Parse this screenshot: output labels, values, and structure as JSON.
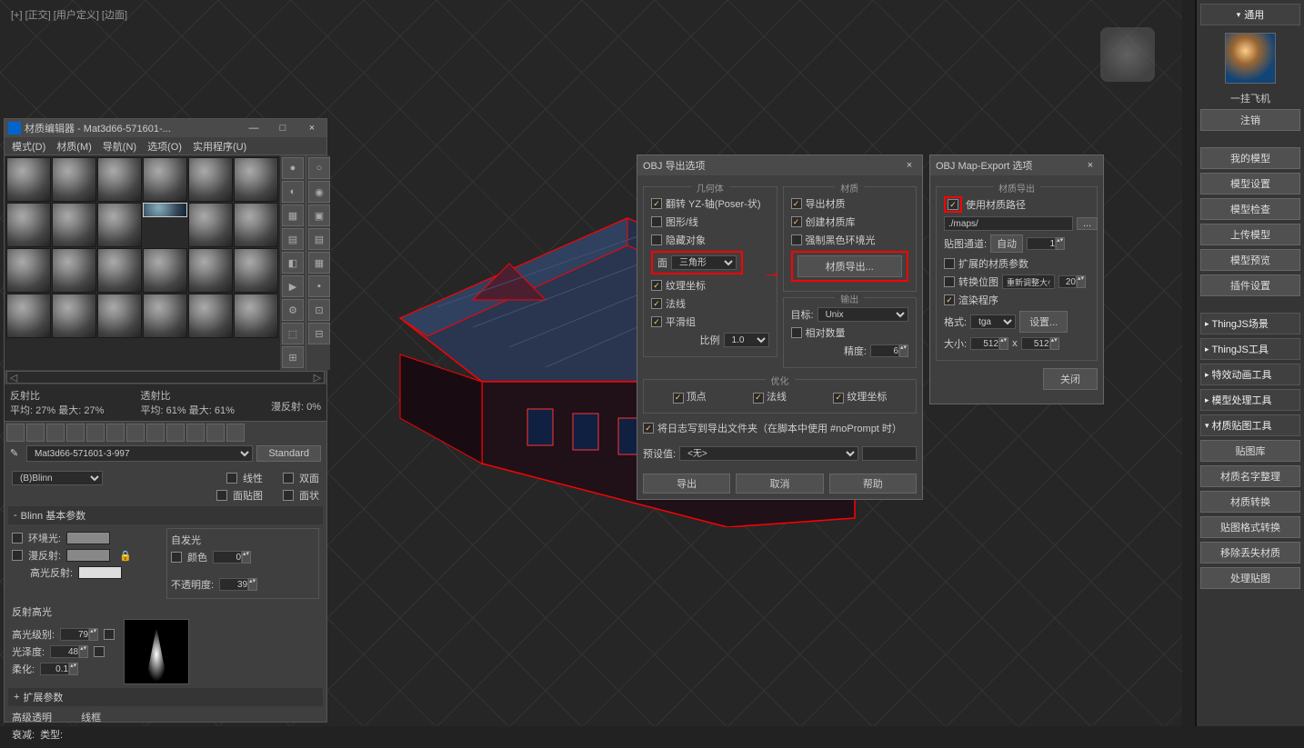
{
  "viewport_label": "[+] [正交] [用户定义] [边面]",
  "mateditor": {
    "title": "材质编辑器 - Mat3d66-571601-...",
    "menus": [
      "模式(D)",
      "材质(M)",
      "导航(N)",
      "选项(O)",
      "实用程序(U)"
    ],
    "stats": {
      "refl_label": "反射比",
      "refl_avg_label": "平均:",
      "refl_avg": "27%",
      "refl_max_label": "最大:",
      "refl_max": "27%",
      "trans_label": "透射比",
      "trans_avg": "61%",
      "trans_max": "61%",
      "diff_label": "漫反射:",
      "diff_val": "0%"
    },
    "mat_name": "Mat3d66-571601-3-997",
    "mat_type": "Standard",
    "shader": "(B)Blinn",
    "shader_opts": {
      "xianxing": "线性",
      "shuangmian": "双面",
      "mian_tie": "面贴图",
      "mian_zhuang": "面状"
    },
    "rollout_blinn": "Blinn 基本参数",
    "self_illum": "自发光",
    "color_label": "颜色",
    "color_val": "0",
    "ambient_label": "环境光:",
    "diffuse_label": "漫反射:",
    "specular_label": "高光反射:",
    "opacity_label": "不透明度:",
    "opacity_val": "39",
    "spec_hl": "反射高光",
    "spec_level": "高光级别:",
    "spec_level_val": "79",
    "gloss": "光泽度:",
    "gloss_val": "48",
    "soften": "柔化:",
    "soften_val": "0.1",
    "rollout_ext": "扩展参数",
    "adv_label": "高级透明",
    "falloff": "衰减:",
    "type": "类型:",
    "wireframe": "线框"
  },
  "objexport": {
    "title": "OBJ 导出选项",
    "geom_legend": "几何体",
    "flip_yz": "翻转 YZ-轴(Poser-状)",
    "shapes": "图形/线",
    "hidden": "隐藏对象",
    "faces_label": "面",
    "faces_type": "三角形",
    "texcoord": "纹理坐标",
    "normals": "法线",
    "smoothgrp": "平滑组",
    "scale_label": "比例",
    "scale_val": "1.0",
    "mat_legend": "材质",
    "export_mat": "导出材质",
    "create_mtl": "创建材质库",
    "force_black": "强制黑色环境光",
    "mat_export_btn": "材质导出...",
    "output_legend": "输出",
    "target_label": "目标:",
    "target_val": "Unix",
    "rel_count": "相对数量",
    "precision_label": "精度:",
    "precision_val": "6",
    "opt_legend": "优化",
    "opt_vertex": "顶点",
    "opt_normal": "法线",
    "opt_tex": "纹理坐标",
    "log_label": "将日志写到导出文件夹（在脚本中使用 #noPrompt 时）",
    "preset_label": "预设值:",
    "preset_val": "<无>",
    "btn_export": "导出",
    "btn_cancel": "取消",
    "btn_help": "帮助"
  },
  "mapexport": {
    "title": "OBJ Map-Export 选项",
    "legend": "材质导出",
    "use_path": "使用材质路径",
    "path_val": "./maps/",
    "channel_label": "贴图通道:",
    "channel_auto": "自动",
    "channel_num": "1",
    "ext_params": "扩展的材质参数",
    "convert_bmp": "转换位图",
    "convert_val": "重新调整大小",
    "convert_num": "20",
    "render_proc": "渲染程序",
    "format_label": "格式:",
    "format_val": "tga",
    "setup": "设置...",
    "size_label": "大小:",
    "size_w": "512",
    "size_h": "512",
    "x": "x",
    "close": "关闭"
  },
  "rightpanel": {
    "general": "通用",
    "user": "一挂飞机",
    "logout": "注销",
    "btns": [
      "我的模型",
      "模型设置",
      "模型检查",
      "上传模型",
      "模型预览",
      "插件设置"
    ],
    "sections": [
      "ThingJS场景",
      "ThingJS工具",
      "特效动画工具",
      "模型处理工具"
    ],
    "tex_section": "材质贴图工具",
    "tex_btns": [
      "贴图库",
      "材质名字整理",
      "材质转换",
      "贴图格式转换",
      "移除丢失材质",
      "处理贴图"
    ]
  }
}
